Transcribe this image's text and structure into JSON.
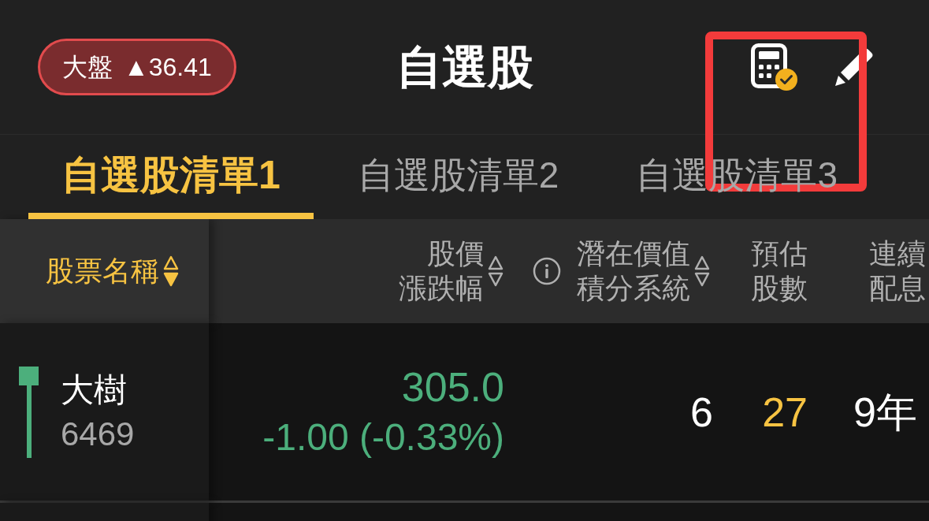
{
  "header": {
    "market_index": {
      "label": "大盤",
      "value": "▲36.41",
      "rising": true
    },
    "title": "自選股",
    "actions": [
      {
        "kind": "calculator"
      },
      {
        "kind": "edit"
      }
    ]
  },
  "annotation": {
    "kind": "rectangle"
  },
  "tabs": [
    {
      "label": "自選股清單1",
      "selected": true
    },
    {
      "label": "自選股清單2",
      "selected": false
    },
    {
      "label": "自選股清單3",
      "selected": false
    }
  ],
  "table": {
    "columns": [
      {
        "lines": [
          "股票名稱"
        ],
        "sorted": true
      },
      {
        "lines": [
          "股價",
          "漲跌幅"
        ],
        "sorted": false
      },
      {
        "lines": [
          "潛在價值",
          "積分系統"
        ],
        "sorted": false,
        "info": true
      },
      {
        "lines": [
          "預估",
          "股數"
        ]
      },
      {
        "lines": [
          "連續",
          "配息"
        ]
      }
    ],
    "rows": [
      {
        "rising": false,
        "cells": [
          {
            "kind": "stock",
            "name": "大樹",
            "code": "6469",
            "color": "#4caf7c"
          },
          {
            "kind": "quote",
            "price": "305.0",
            "change": "-1.00 (-0.33%)"
          },
          {
            "kind": "number",
            "text": "6",
            "color": "#ffffff"
          },
          {
            "kind": "number",
            "text": "27",
            "color": "#f7c342"
          },
          {
            "kind": "number",
            "text": "9年",
            "color": "#ffffff"
          }
        ]
      }
    ]
  }
}
